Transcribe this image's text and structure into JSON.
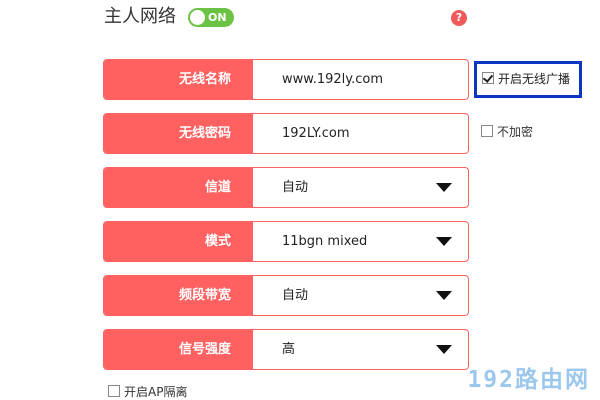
{
  "header": {
    "title": "主人网络",
    "toggle_label": "ON",
    "toggle_state": "on",
    "help_icon": "question-circle-icon"
  },
  "fields": [
    {
      "label": "无线名称",
      "value": "www.192ly.com",
      "type": "text"
    },
    {
      "label": "无线密码",
      "value": "192LY.com",
      "type": "text"
    },
    {
      "label": "信道",
      "value": "自动",
      "type": "select"
    },
    {
      "label": "模式",
      "value": "11bgn mixed",
      "type": "select"
    },
    {
      "label": "频段带宽",
      "value": "自动",
      "type": "select"
    },
    {
      "label": "信号强度",
      "value": "高",
      "type": "select"
    }
  ],
  "options": {
    "broadcast": {
      "label": "开启无线广播",
      "checked": true
    },
    "no_encrypt": {
      "label": "不加密",
      "checked": false
    },
    "ap_isolation": {
      "label": "开启AP隔离",
      "checked": false
    }
  },
  "watermark": "192路由网",
  "colors": {
    "accent": "#ff6161",
    "toggle_on": "#6cc244",
    "highlight_border": "#0b36c4",
    "help_icon": "#f05a5a",
    "watermark": "#9cc8ee"
  }
}
